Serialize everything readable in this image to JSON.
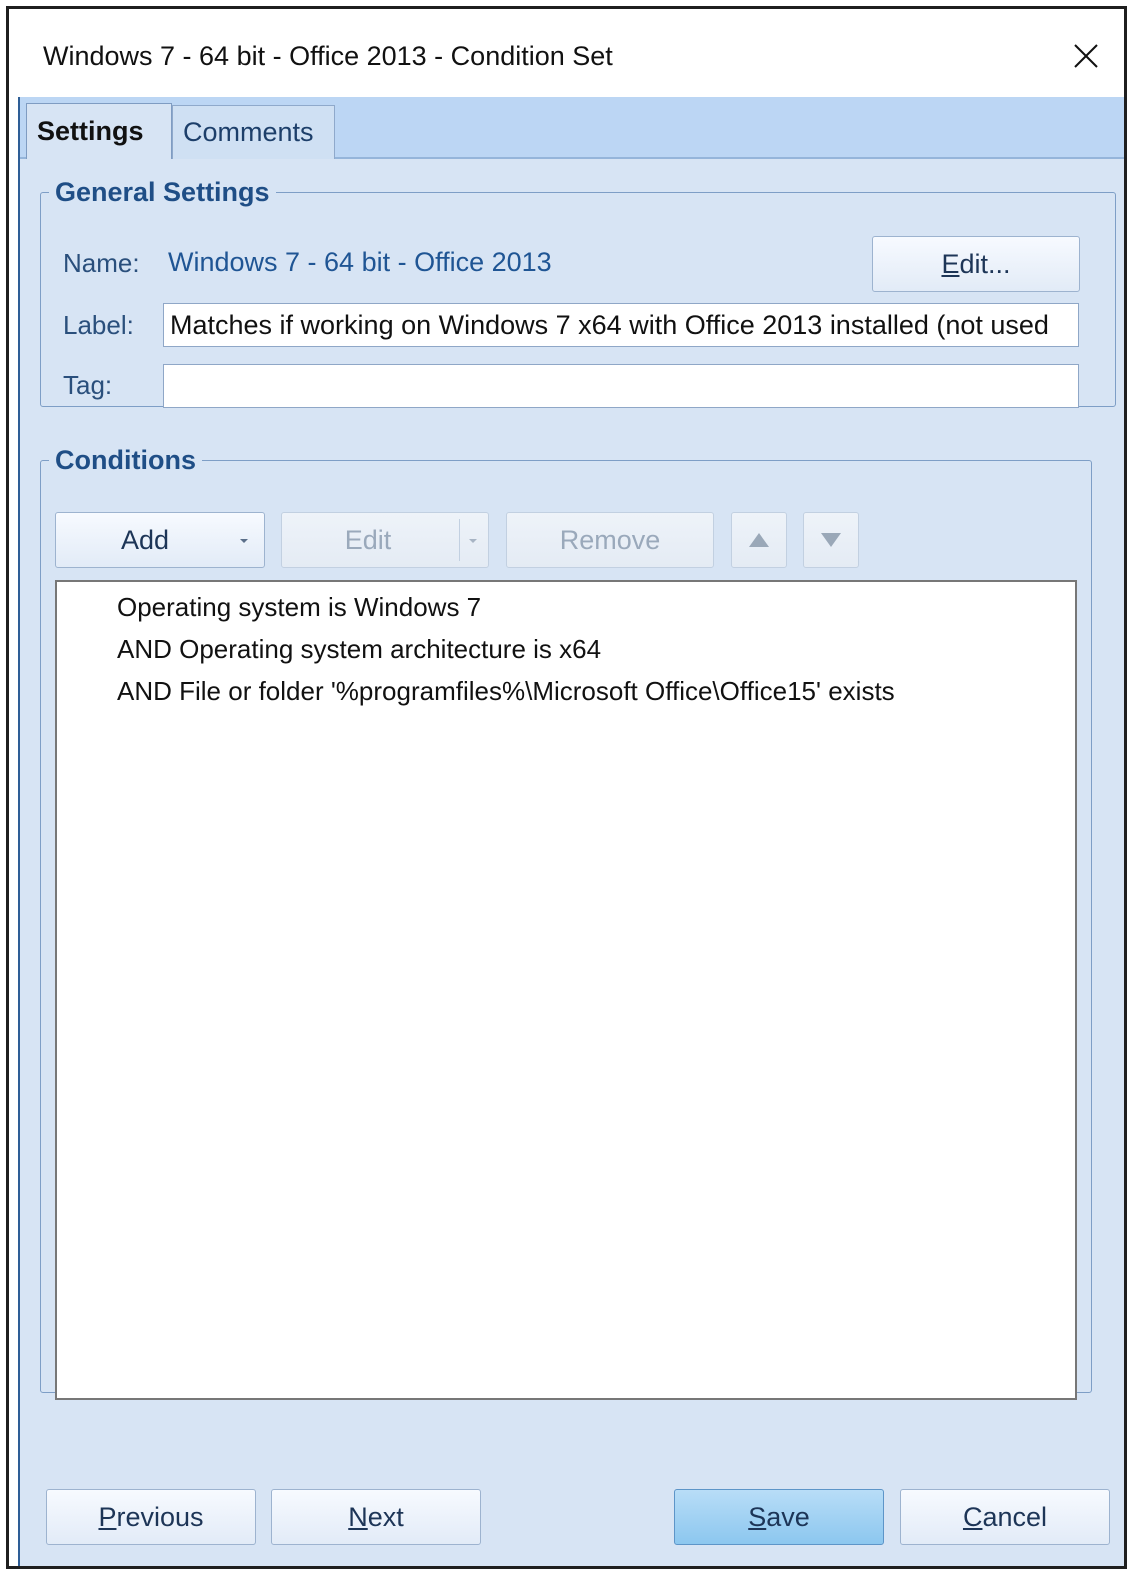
{
  "window": {
    "title": "Windows 7 - 64 bit - Office 2013 - Condition Set",
    "close_icon": "close-icon"
  },
  "tabs": [
    {
      "label": "Settings",
      "active": true
    },
    {
      "label": "Comments",
      "active": false
    }
  ],
  "general": {
    "legend": "General Settings",
    "name_label": "Name:",
    "name_value": "Windows 7 - 64 bit - Office 2013",
    "edit_button": {
      "prefix": "",
      "underline": "E",
      "rest": "dit..."
    },
    "label_label": "Label:",
    "label_value": "Matches if working on Windows 7 x64 with Office 2013 installed (not used",
    "tag_label": "Tag:",
    "tag_value": ""
  },
  "conditions": {
    "legend": "Conditions",
    "toolbar": {
      "add": "Add",
      "edit": "Edit",
      "remove": "Remove",
      "move_up_icon": "triangle-up-icon",
      "move_down_icon": "triangle-down-icon",
      "dropdown_icon": "chevron-down-icon"
    },
    "items": [
      "Operating system is Windows 7",
      "AND Operating system architecture is x64",
      "AND File or folder '%programfiles%\\Microsoft Office\\Office15' exists"
    ]
  },
  "footer": {
    "previous": {
      "underline": "P",
      "rest": "revious"
    },
    "next": {
      "underline": "N",
      "rest": "ext"
    },
    "save": {
      "underline": "S",
      "rest": "ave"
    },
    "cancel": {
      "underline": "C",
      "rest": "ancel"
    }
  },
  "colors": {
    "panel_background": "#d7e4f4",
    "tabstrip": "#bcd6f4",
    "accent_text": "#1f4e86",
    "primary_button": "#8cc7ef"
  }
}
